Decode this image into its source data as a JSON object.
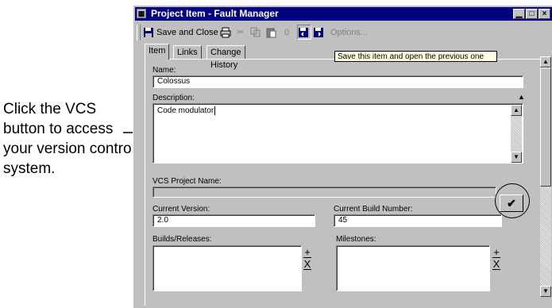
{
  "callout": {
    "text": "Click the VCS button to access your version control system."
  },
  "window": {
    "title": "Project Item - Fault Manager",
    "buttons": {
      "minimize": "▁",
      "maximize": "□",
      "close": "×"
    }
  },
  "toolbar": {
    "save_close_label": "Save and Close",
    "options_label": "Options..."
  },
  "tooltip": {
    "text": "Save this item and open the previous one"
  },
  "tabs": [
    {
      "label": "Item",
      "active": true
    },
    {
      "label": "Links",
      "active": false
    },
    {
      "label": "Change History",
      "active": false
    }
  ],
  "form": {
    "name_label": "Name:",
    "name_value": "Colossus",
    "description_label": "Description:",
    "description_value": "Code modulator",
    "vcs_label": "VCS Project Name:",
    "vcs_value": "",
    "vcs_button_glyph": "✔",
    "current_version_label": "Current Version:",
    "current_version_value": "2.0",
    "current_build_label": "Current Build Number:",
    "current_build_value": "45",
    "builds_label": "Builds/Releases:",
    "milestones_label": "Milestones:",
    "add_glyph": "+",
    "remove_glyph": "X"
  },
  "icons": [
    "window-icon",
    "save-close-icon",
    "print-icon",
    "cut-icon",
    "copy-icon",
    "paste-icon",
    "attach-icon",
    "previous-item-icon",
    "next-item-icon",
    "checkmark-icon"
  ]
}
